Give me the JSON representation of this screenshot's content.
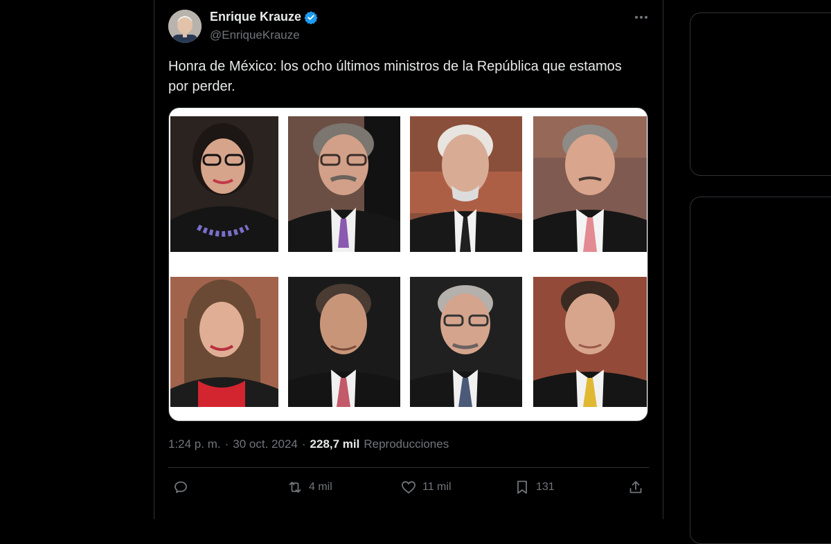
{
  "tweet": {
    "author_name": "Enrique Krauze",
    "author_handle": "@EnriqueKrauze",
    "text": "Honra de México: los ocho últimos ministros de la República que estamos por perder.",
    "time": "1:24 p. m.",
    "date": "30 oct. 2024",
    "views_count": "228,7 mil",
    "views_label": "Reproducciones",
    "separator": "·"
  },
  "actions": {
    "replies": "",
    "reposts": "4 mil",
    "likes": "11 mil",
    "bookmarks": "131"
  },
  "icons": [
    "verified-badge-icon",
    "more-options-icon",
    "reply-icon",
    "repost-icon",
    "like-icon",
    "bookmark-icon",
    "share-icon"
  ],
  "colors": {
    "verified": "#1d9bf0",
    "text": "#e7e9ea",
    "muted": "#71767b",
    "border": "#2f3336"
  }
}
